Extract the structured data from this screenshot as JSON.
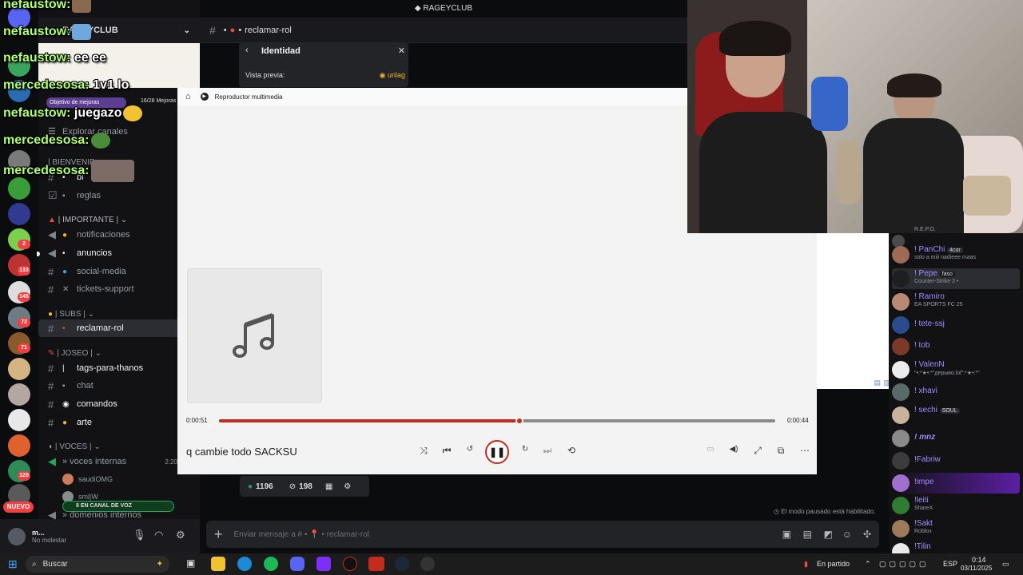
{
  "server": {
    "name": "RAGEYCLUB",
    "header_name": "RAGEYCLUB"
  },
  "rail_badges": [
    "2",
    "133",
    "145",
    "72",
    "71",
    "120"
  ],
  "rail_new_label": "NUEVO",
  "goal": {
    "label": "Objetivo de mejoras",
    "progress": "16/28 Mejoras"
  },
  "explore_label": "Explorar canales",
  "channels": {
    "welcome_category": "| BIENVENID",
    "bienvenida": "bi",
    "reglas": "reglas",
    "importante_category": "| IMPORTANTE |",
    "notificaciones": "notificaciones",
    "anuncios": "anuncios",
    "social_media": "social-media",
    "tickets": "tickets-support",
    "subs_category": "| SUBS |",
    "reclamar_rol": "reclamar-rol",
    "joseo_category": "| JOSEO |",
    "tags": "tags-para-thanos",
    "chat": "chat",
    "comandos": "comandos",
    "arte": "arte",
    "voces_category": "| VOCES |",
    "voces_internas": "» voces internas",
    "voces_time": "2:20",
    "voice_user1": "saudiOMG",
    "voice_user2": "sml|W",
    "voice_status": "8 EN CANAL DE VOZ",
    "domenios": "» domenios internos"
  },
  "user": {
    "name": "m...",
    "status": "No molestar"
  },
  "chat_overlay": [
    {
      "name": "nefaustow:",
      "text": ""
    },
    {
      "name": "nefaustow:",
      "text": ""
    },
    {
      "name": "nefaustow:",
      "text": "ee ee"
    },
    {
      "name": "mercedesosa:",
      "text": "1v1 lo"
    },
    {
      "name": "nefaustow:",
      "text": "juegazo"
    },
    {
      "name": "mercedesosa:",
      "text": ""
    },
    {
      "name": "mercedesosa:",
      "text": ""
    }
  ],
  "channel_header": {
    "name": "reclamar-rol"
  },
  "identity_panel": {
    "title": "Identidad",
    "preview_label": "Vista previa:",
    "preview_user": "urilag"
  },
  "player": {
    "app_title": "Reproductor multimedia",
    "song": "q cambie todo SACKSU",
    "elapsed": "0:00:51",
    "remaining": "0:00:44",
    "progress": 0.54
  },
  "stats": {
    "left": "1196",
    "right": "198"
  },
  "slowmode": "El modo pausado está habilitado.",
  "message_placeholder": "Enviar mensaje a # • 📍 • reclamar-rol",
  "members": [
    {
      "name": "",
      "sub": "R.E.P.O.",
      "color": "#a38bff"
    },
    {
      "name": "! PanChi",
      "tag": "4cor",
      "sub": "solo a miii nadieee maas",
      "color": "#a38bff"
    },
    {
      "name": "! Pepe",
      "tag": "faso",
      "sub": "Counter-Strike 2 •",
      "color": "#a38bff"
    },
    {
      "name": "! Ramiro",
      "sub": "EA SPORTS FC 25",
      "color": "#a38bff"
    },
    {
      "name": "! tete-ssj",
      "sub": "",
      "color": "#a38bff"
    },
    {
      "name": "! tob",
      "sub": "",
      "color": "#a38bff"
    },
    {
      "name": "! ValenN",
      "sub": "\"•:*★•:*\"дерьмо.lol\":*★•:*\"",
      "color": "#a38bff"
    },
    {
      "name": "! xhavi",
      "sub": "",
      "color": "#a38bff"
    },
    {
      "name": "! sechi",
      "tag": "SOUL",
      "sub": "",
      "color": "#a38bff"
    },
    {
      "name": "! mnz",
      "sub": "",
      "color": "#a38bff"
    },
    {
      "name": "!Fabriw",
      "sub": "",
      "color": "#a38bff"
    },
    {
      "name": "!impe",
      "sub": "",
      "color": "#a38bff"
    },
    {
      "name": "!leiti",
      "sub": "ShareX",
      "color": "#a38bff"
    },
    {
      "name": "!Sakt",
      "sub": "Roblox",
      "color": "#a38bff"
    },
    {
      "name": "!Tilin",
      "sub": "",
      "color": "#a38bff"
    }
  ],
  "stream_header": "RAGEYCLUB",
  "taskbar": {
    "search_placeholder": "Buscar",
    "match_status": "En partido",
    "language": "ESP",
    "time": "0:14",
    "date": "03/11/2025"
  },
  "colors": {
    "accent": "#c42b1c",
    "discord_bg": "#121214",
    "member_name": "#a38bff"
  }
}
